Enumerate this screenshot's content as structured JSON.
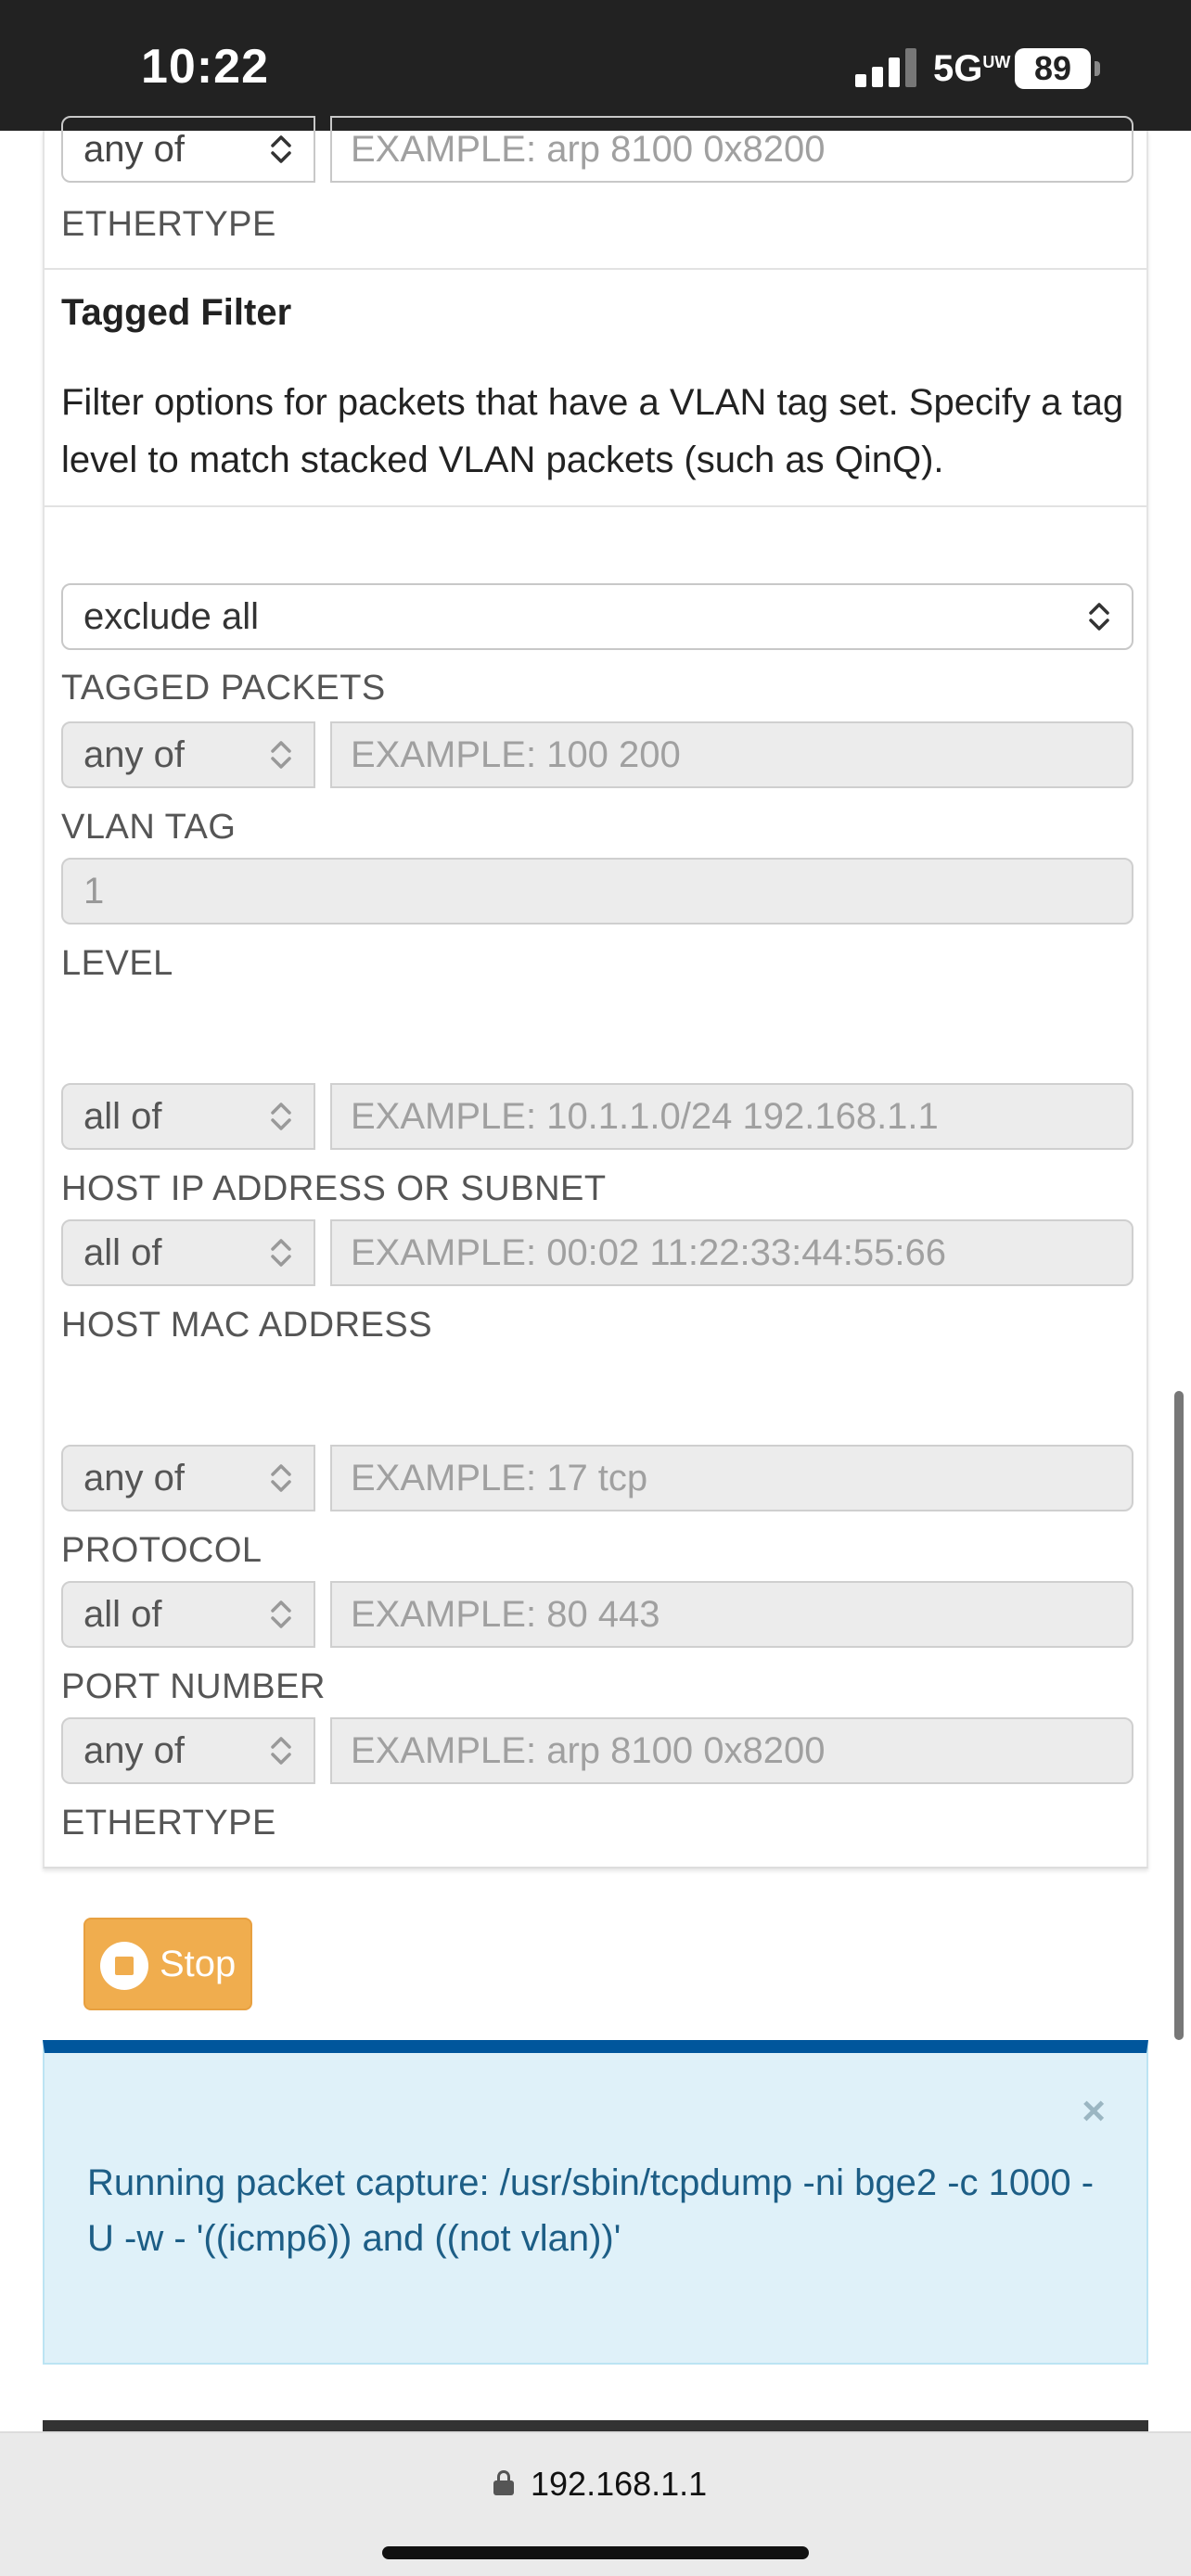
{
  "status_bar": {
    "time": "10:22",
    "network": "5G",
    "network_suffix": "UW",
    "battery": "89"
  },
  "top_row": {
    "select": "any of",
    "placeholder": "EXAMPLE: arp 8100 0x8200",
    "label": "ETHERTYPE"
  },
  "tagged_filter": {
    "title": "Tagged Filter",
    "description": "Filter options for packets that have a VLAN tag set. Specify a tag level to match stacked VLAN packets (such as QinQ).",
    "tagged_packets": {
      "select": "exclude all",
      "label": "TAGGED PACKETS"
    },
    "vlan_tag": {
      "select": "any of",
      "placeholder": "EXAMPLE: 100 200",
      "label": "VLAN TAG"
    },
    "level": {
      "value": "1",
      "label": "LEVEL"
    }
  },
  "host_filter": {
    "ip": {
      "select": "all of",
      "placeholder": "EXAMPLE: 10.1.1.0/24 192.168.1.1",
      "label": "HOST IP ADDRESS OR SUBNET"
    },
    "mac": {
      "select": "all of",
      "placeholder": "EXAMPLE: 00:02 11:22:33:44:55:66",
      "label": "HOST MAC ADDRESS"
    }
  },
  "protocol_filter": {
    "protocol": {
      "select": "any of",
      "placeholder": "EXAMPLE: 17 tcp",
      "label": "PROTOCOL"
    },
    "port": {
      "select": "all of",
      "placeholder": "EXAMPLE: 80 443",
      "label": "PORT NUMBER"
    },
    "ethertype": {
      "select": "any of",
      "placeholder": "EXAMPLE: arp 8100 0x8200",
      "label": "ETHERTYPE"
    }
  },
  "stop_button": {
    "label": "Stop"
  },
  "alert": {
    "close": "×",
    "message": "Running packet capture: /usr/sbin/tcpdump -ni bge2 -c 1000 -U -w - '((icmp6)) and ((not vlan))'"
  },
  "browser": {
    "url": "192.168.1.1"
  },
  "colors": {
    "warning": "#f0ad4e",
    "info_bg": "#dff1f9",
    "info_border_top": "#00569c",
    "info_text": "#1d5e86"
  }
}
